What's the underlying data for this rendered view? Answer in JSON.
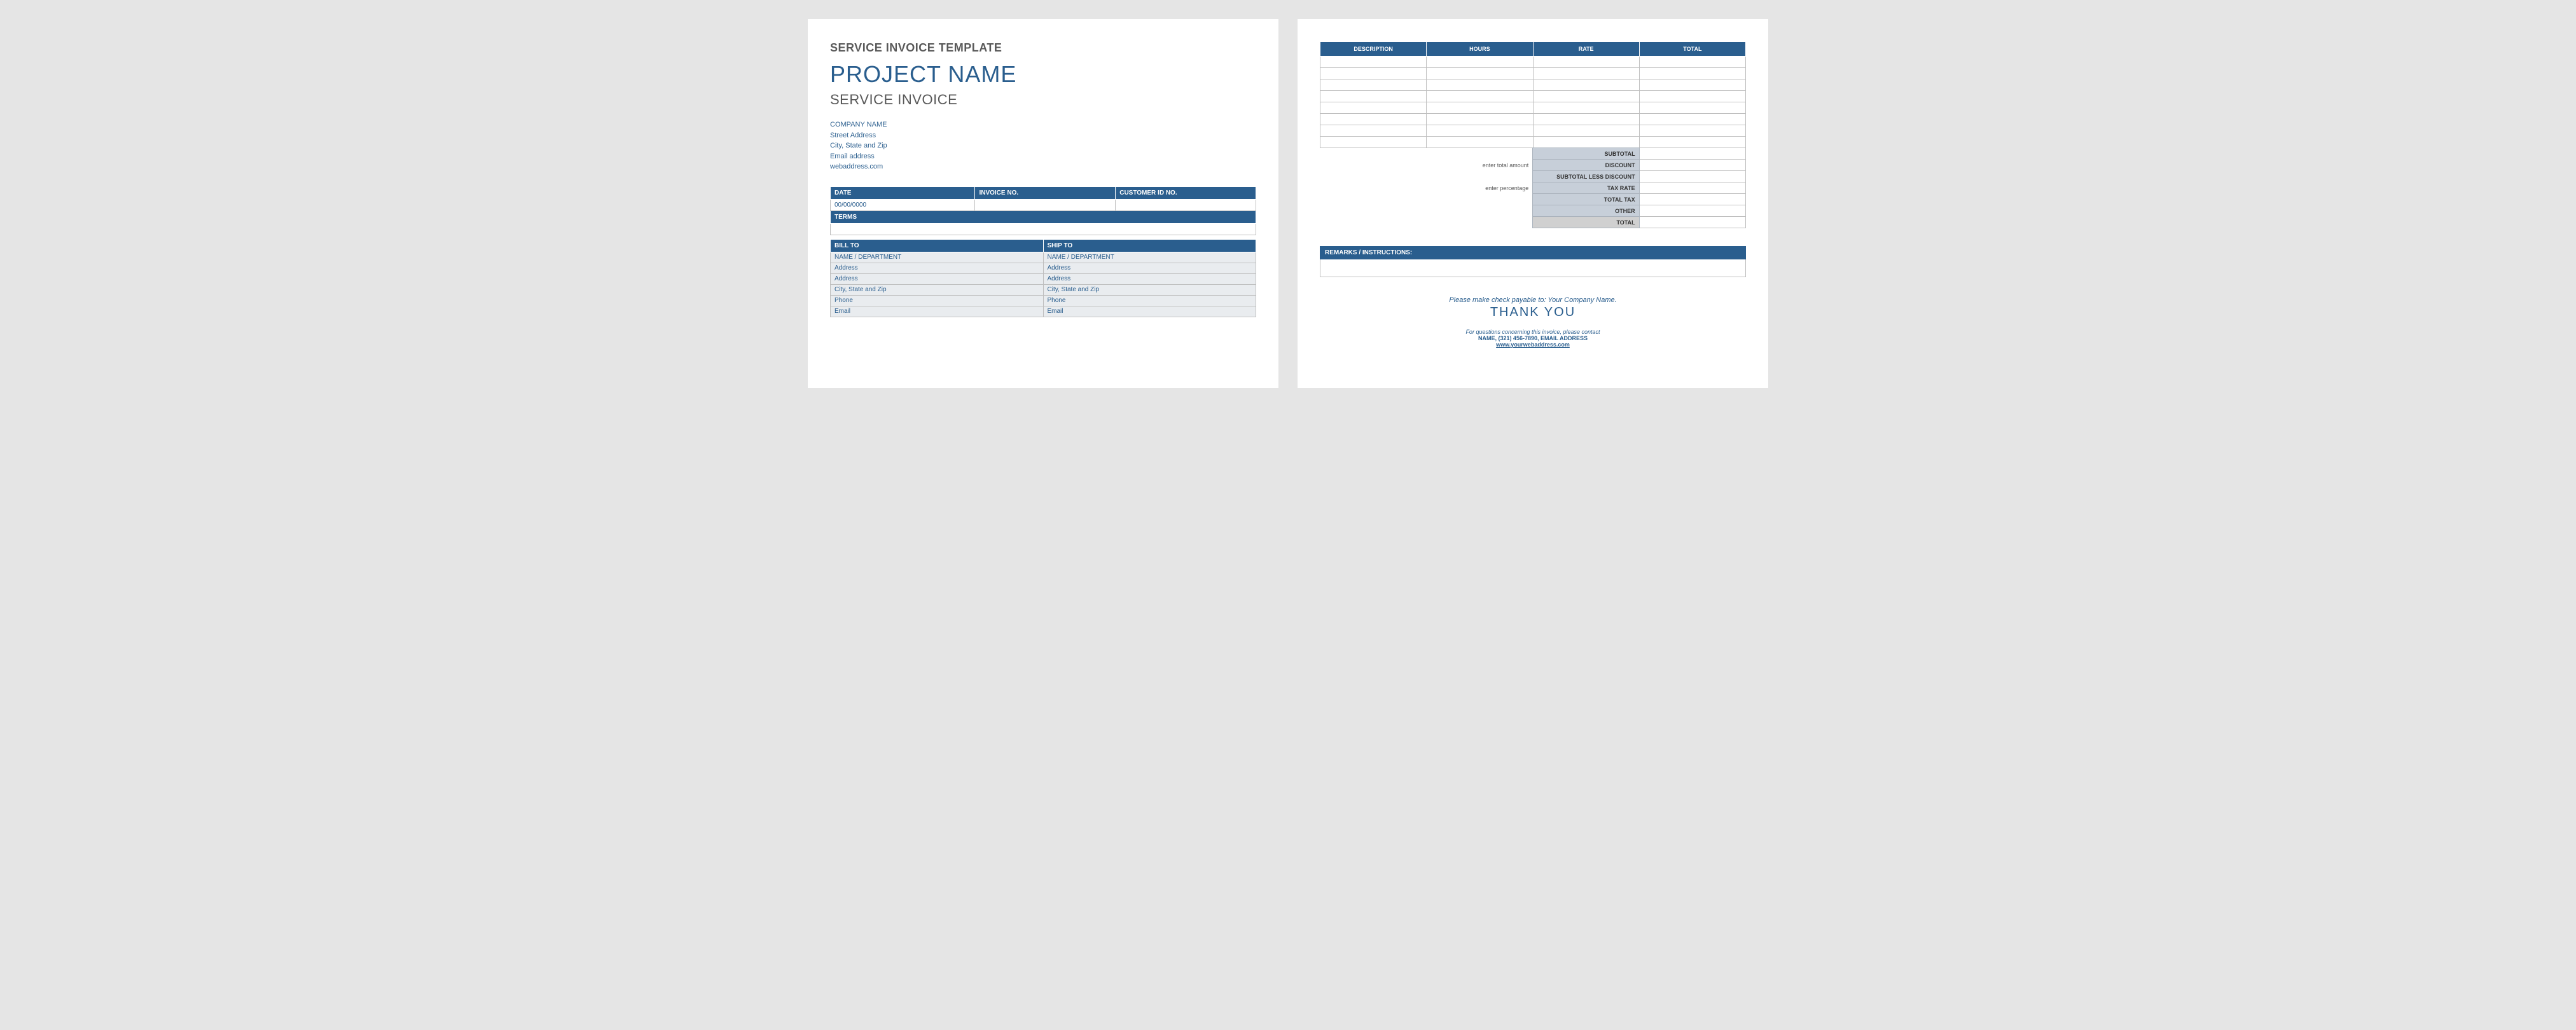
{
  "page1": {
    "template_title": "SERVICE INVOICE TEMPLATE",
    "project_name": "PROJECT NAME",
    "subtitle": "SERVICE INVOICE",
    "company": {
      "name": "COMPANY NAME",
      "street": "Street Address",
      "city": "City, State and Zip",
      "email": "Email address",
      "web": "webaddress.com"
    },
    "meta_headers": {
      "date": "DATE",
      "invoice_no": "INVOICE NO.",
      "customer_id": "CUSTOMER ID NO."
    },
    "meta_values": {
      "date": "00/00/0000",
      "invoice_no": "",
      "customer_id": ""
    },
    "terms_header": "TERMS",
    "billto_header": "BILL TO",
    "shipto_header": "SHIP TO",
    "addr": {
      "name": "NAME / DEPARTMENT",
      "addr1": "Address",
      "addr2": "Address",
      "city": "City, State and Zip",
      "phone": "Phone",
      "email": "Email"
    }
  },
  "page2": {
    "cols": {
      "desc": "DESCRIPTION",
      "hours": "HOURS",
      "rate": "RATE",
      "total": "TOTAL"
    },
    "row_count": 8,
    "hints": {
      "amount": "enter total amount",
      "percent": "enter percentage"
    },
    "totals": {
      "subtotal": "SUBTOTAL",
      "discount": "DISCOUNT",
      "sub_less": "SUBTOTAL LESS DISCOUNT",
      "tax_rate": "TAX RATE",
      "total_tax": "TOTAL TAX",
      "other": "OTHER",
      "total": "TOTAL"
    },
    "remarks_header": "REMARKS / INSTRUCTIONS:",
    "footer": {
      "payable": "Please make check payable to: Your Company Name.",
      "thanks": "THANK YOU",
      "questions": "For questions concerning this invoice, please contact",
      "contact": "NAME, (321) 456-7890, EMAIL ADDRESS",
      "website": "www.yourwebaddress.com"
    }
  }
}
